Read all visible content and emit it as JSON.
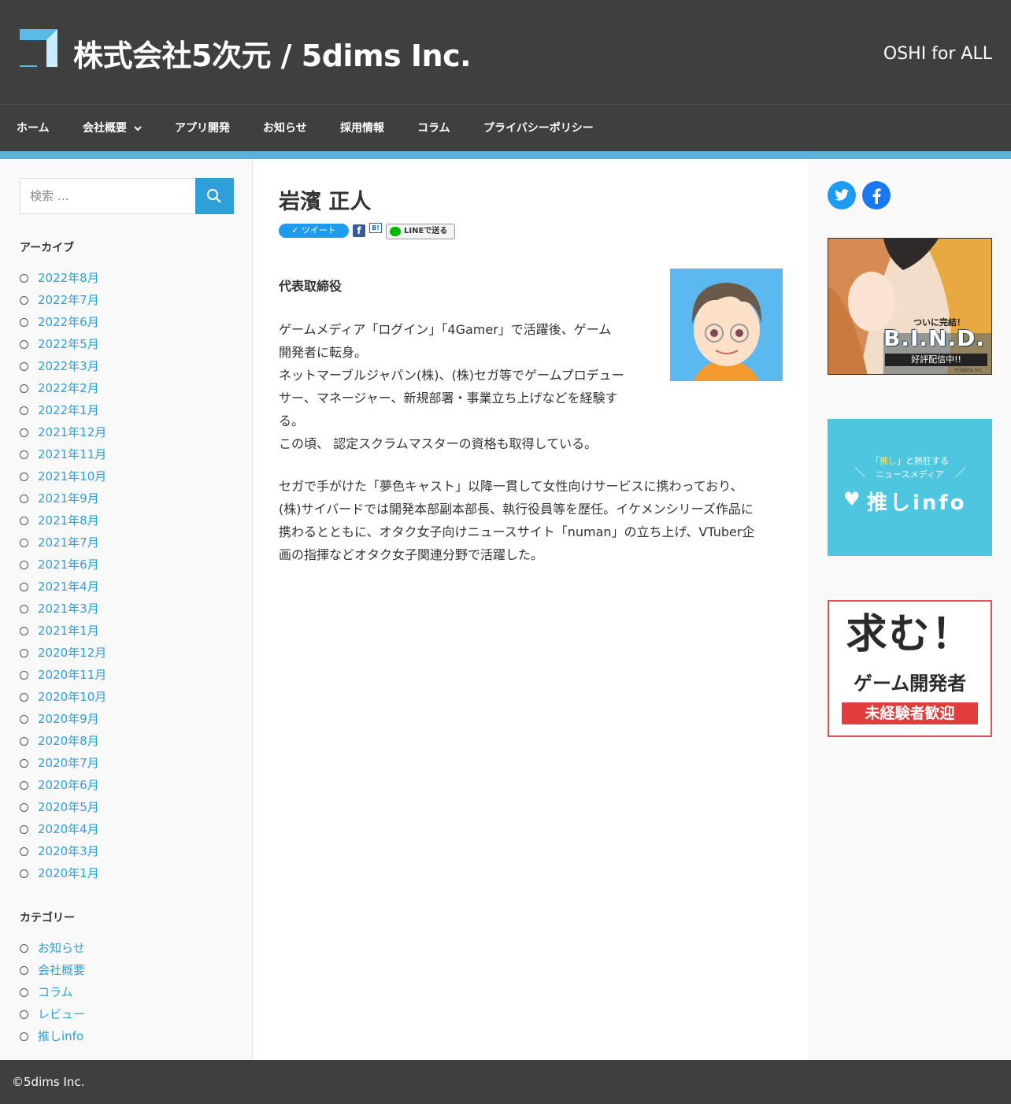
{
  "header": {
    "site_title": "株式会社5次元 / 5dims Inc.",
    "tagline": "OSHI for ALL"
  },
  "nav": {
    "items": [
      "ホーム",
      "会社概要",
      "アプリ開発",
      "お知らせ",
      "採用情報",
      "コラム",
      "プライバシーポリシー"
    ]
  },
  "sidebar": {
    "search_placeholder": "検索 …",
    "archive_title": "アーカイブ",
    "archives": [
      "2022年8月",
      "2022年7月",
      "2022年6月",
      "2022年5月",
      "2022年3月",
      "2022年2月",
      "2022年1月",
      "2021年12月",
      "2021年11月",
      "2021年10月",
      "2021年9月",
      "2021年8月",
      "2021年7月",
      "2021年6月",
      "2021年4月",
      "2021年3月",
      "2021年1月",
      "2020年12月",
      "2020年11月",
      "2020年10月",
      "2020年9月",
      "2020年8月",
      "2020年7月",
      "2020年6月",
      "2020年5月",
      "2020年4月",
      "2020年3月",
      "2020年1月"
    ],
    "category_title": "カテゴリー",
    "categories": [
      "お知らせ",
      "会社概要",
      "コラム",
      "レビュー",
      "推しinfo"
    ]
  },
  "post": {
    "title": "岩濱 正人",
    "share": {
      "tweet": "ツイート",
      "facebook": "f",
      "hatena": "B!",
      "line": "LINEで送る"
    },
    "role": "代表取締役",
    "para1_lines": [
      "ゲームメディア「ログイン」「4Gamer」で活躍後、ゲーム",
      "開発者に転身。",
      "ネットマーブルジャパン(株)、(株)セガ等でゲームプロデュー",
      "サー、マネージャー、新規部署・事業立ち上げなどを経験す",
      "る。",
      "この頃、 認定スクラムマスターの資格も取得している。"
    ],
    "para2_lines": [
      "セガで手がけた「夢色キャスト」以降一貫して女性向けサービスに携わっており、",
      "(株)サイバードでは開発本部副本部長、執行役員等を歴任。イケメンシリーズ作品に",
      "携わるとともに、オタク女子向けニュースサイト「numan」の立ち上げ、VTuber企",
      "画の指揮などオタク女子関連分野で活躍した。"
    ]
  },
  "right": {
    "bind_text": "B.I.N.D.",
    "bind_sub": "ついに完結！",
    "bind_badge": "好評配信中!!",
    "bind_credit": "©5dims Inc.",
    "oshi_line1_pre": "「",
    "oshi_line1_hl": "推し",
    "oshi_line1_post": "」と熱狂する",
    "oshi_line2": "ニュースメディア",
    "oshi_logo": "推しinfo",
    "rec_line1": "求む！",
    "rec_line2": "ゲーム開発者",
    "rec_line3": "未経験者歓迎"
  },
  "footer": {
    "copyright": "©5dims Inc."
  }
}
